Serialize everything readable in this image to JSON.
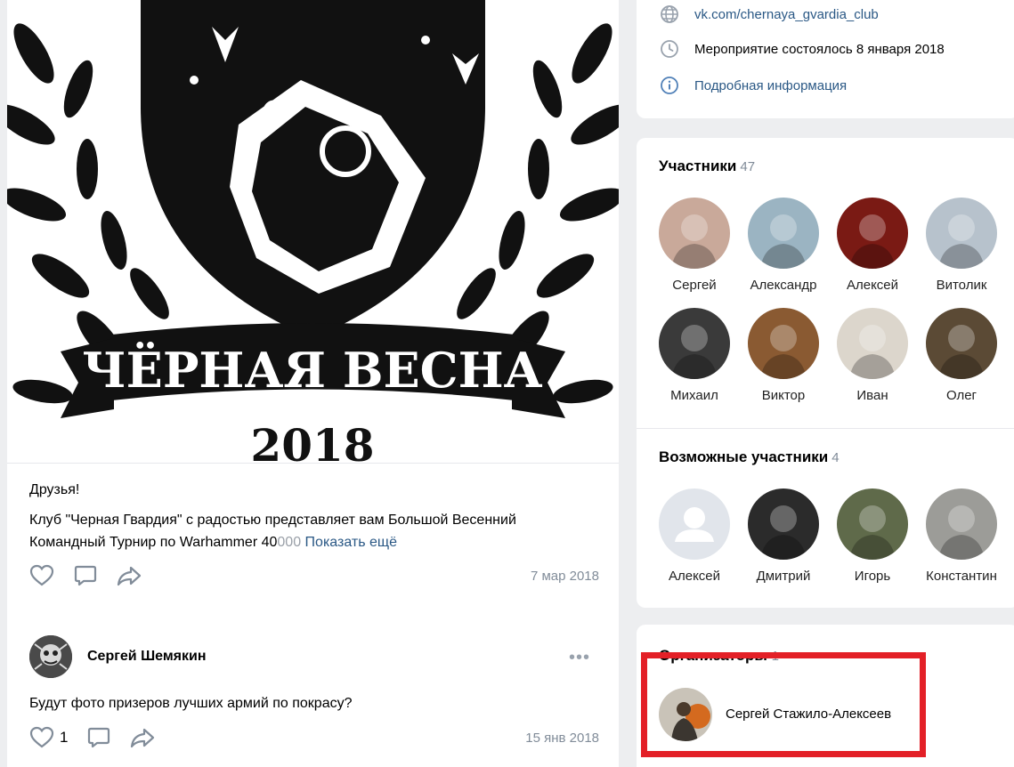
{
  "post": {
    "cover_title": "ЧЁРНАЯ ВЕСНА",
    "cover_year": "2018",
    "text_line1": "Друзья!",
    "text_line2": "Клуб \"Черная Гвардия\" с радостью представляет вам Большой Весенний",
    "text_line3_prefix": "Командный Турнир по Warhammer 40",
    "text_line3_fade": "000",
    "show_more": "Показать ещё",
    "date": "7 мар 2018"
  },
  "comment": {
    "author": "Сергей Шемякин",
    "text": "Будут фото призеров лучших армий по покрасу?",
    "likes": "1",
    "date": "15 янв 2018",
    "menu": "•••"
  },
  "info": {
    "link": "vk.com/chernaya_gvardia_club",
    "event_status": "Мероприятие состоялось 8 января 2018",
    "details_link": "Подробная информация"
  },
  "members": {
    "title": "Участники",
    "count": "47",
    "people": [
      {
        "name": "Сергей",
        "color": "#c9a99a"
      },
      {
        "name": "Александр",
        "color": "#9bb4c2"
      },
      {
        "name": "Алексей",
        "color": "#7a1a14"
      },
      {
        "name": "Витолик",
        "color": "#b7c2cc"
      },
      {
        "name": "Михаил",
        "color": "#3a3a3a"
      },
      {
        "name": "Виктор",
        "color": "#8a5a32"
      },
      {
        "name": "Иван",
        "color": "#dcd6cc"
      },
      {
        "name": "Олег",
        "color": "#5b4a35"
      }
    ]
  },
  "possible": {
    "title": "Возможные участники",
    "count": "4",
    "people": [
      {
        "name": "Алексей",
        "color": "#e1e5eb"
      },
      {
        "name": "Дмитрий",
        "color": "#2b2b2b"
      },
      {
        "name": "Игорь",
        "color": "#5f6a4a"
      },
      {
        "name": "Константин",
        "color": "#9c9c98"
      }
    ]
  },
  "organizers": {
    "title": "Организаторы",
    "count": "1",
    "name": "Сергей Стажило-Алексеев"
  },
  "colors": {
    "link": "#2a5885",
    "highlight": "#e32027",
    "muted": "#818c99"
  }
}
